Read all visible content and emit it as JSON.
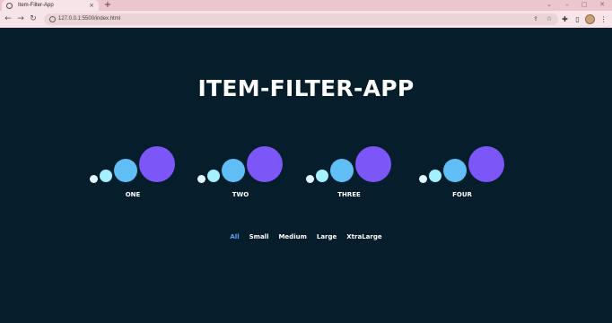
{
  "browser": {
    "tab_title": "Item-Filter-App",
    "tab_close": "×",
    "new_tab": "+",
    "url": "127.0.0.1:5500/index.html",
    "icons": {
      "back": "arrow-left-icon",
      "forward": "arrow-right-icon",
      "reload": "reload-icon",
      "share": "share-icon",
      "bookmark": "star-icon",
      "extensions": "puzzle-icon",
      "sidepanel": "side-panel-icon",
      "menu": "kebab-menu-icon"
    }
  },
  "page": {
    "title": "ITEM-FILTER-APP"
  },
  "items": [
    {
      "label": "ONE"
    },
    {
      "label": "TWO"
    },
    {
      "label": "THREE"
    },
    {
      "label": "FOUR"
    }
  ],
  "filters": [
    {
      "label": "All",
      "active": true
    },
    {
      "label": "Small",
      "active": false
    },
    {
      "label": "Medium",
      "active": false
    },
    {
      "label": "Large",
      "active": false
    },
    {
      "label": "XtraLarge",
      "active": false
    }
  ],
  "colors": {
    "background": "#061e2c",
    "accent": "#5aa6f0",
    "dot_xs": "#dff6ff",
    "dot_s": "#a4f0ff",
    "dot_m": "#5fbef5",
    "dot_l": "#7c56f7"
  }
}
